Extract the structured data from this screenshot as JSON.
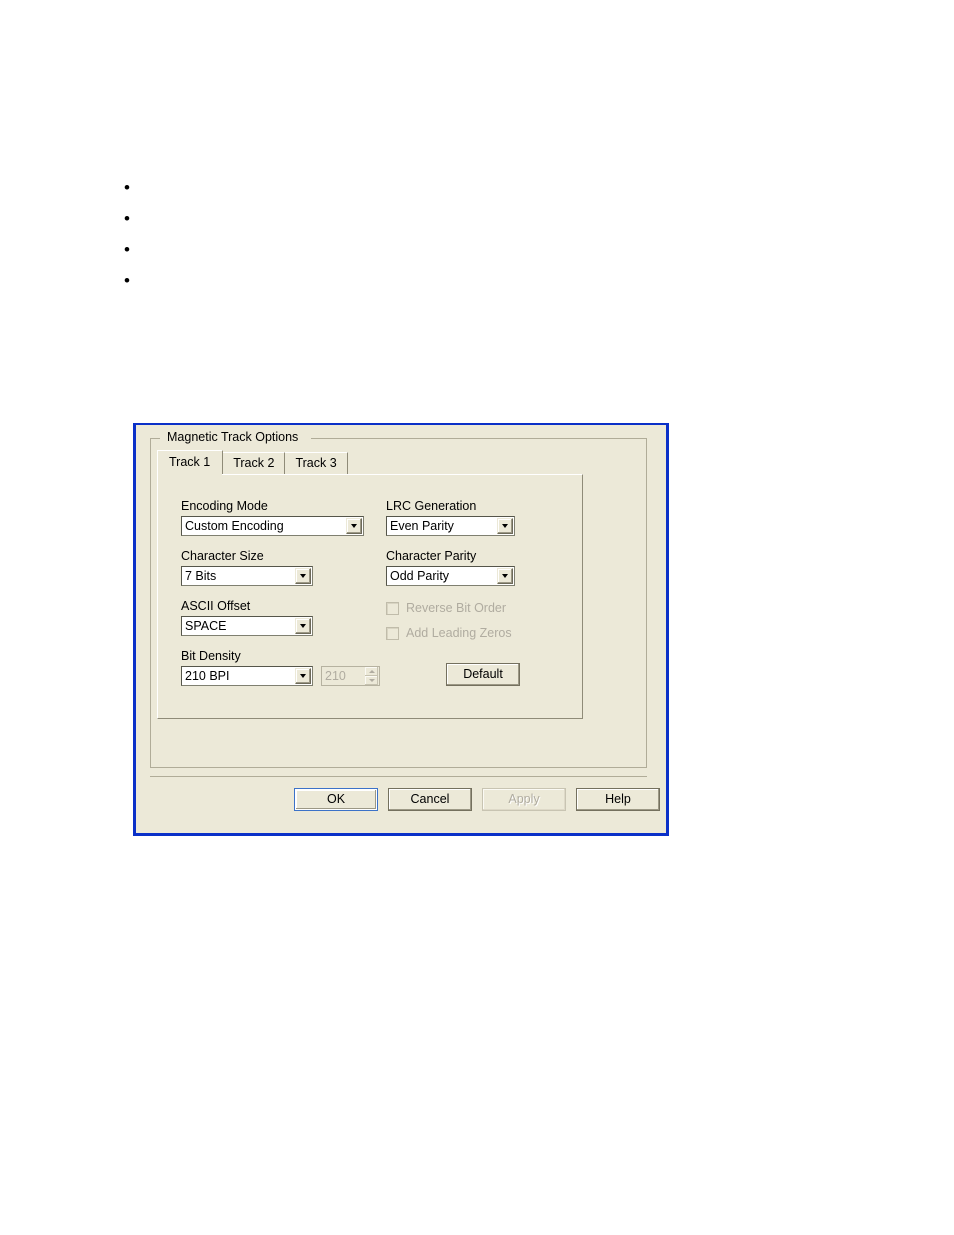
{
  "page": {
    "bullets": [
      "",
      "",
      "",
      ""
    ]
  },
  "dialog": {
    "groupbox_title": "Magnetic Track Options",
    "accent_color": "#0a30c8",
    "face_color": "#ece9d8",
    "tabs": [
      {
        "label": "Track 1",
        "selected": true
      },
      {
        "label": "Track 2",
        "selected": false
      },
      {
        "label": "Track 3",
        "selected": false
      }
    ],
    "fields": {
      "encoding_mode": {
        "label": "Encoding Mode",
        "value": "Custom Encoding",
        "arrow_icon": "chevron-down-icon"
      },
      "character_size": {
        "label": "Character Size",
        "value": "7 Bits",
        "arrow_icon": "chevron-down-icon"
      },
      "ascii_offset": {
        "label": "ASCII Offset",
        "value": "SPACE",
        "arrow_icon": "chevron-down-icon"
      },
      "bit_density": {
        "label": "Bit Density",
        "value": "210 BPI",
        "arrow_icon": "chevron-down-icon"
      },
      "lrc_generation": {
        "label": "LRC Generation",
        "value": "Even Parity",
        "arrow_icon": "chevron-down-icon"
      },
      "character_parity": {
        "label": "Character Parity",
        "value": "Odd Parity",
        "arrow_icon": "chevron-down-icon"
      },
      "bpi_spinner": {
        "value": "210",
        "enabled": false,
        "up_icon": "spinner-up-icon",
        "down_icon": "spinner-down-icon"
      }
    },
    "checkboxes": [
      {
        "label": "Reverse Bit Order",
        "checked": false,
        "enabled": false
      },
      {
        "label": "Add Leading Zeros",
        "checked": false,
        "enabled": false
      }
    ],
    "buttons": {
      "default": {
        "label": "Default",
        "enabled": true
      },
      "ok": {
        "label": "OK",
        "enabled": true,
        "focused": true
      },
      "cancel": {
        "label": "Cancel",
        "enabled": true
      },
      "apply": {
        "label": "Apply",
        "enabled": false
      },
      "help": {
        "label": "Help",
        "enabled": true
      }
    }
  }
}
